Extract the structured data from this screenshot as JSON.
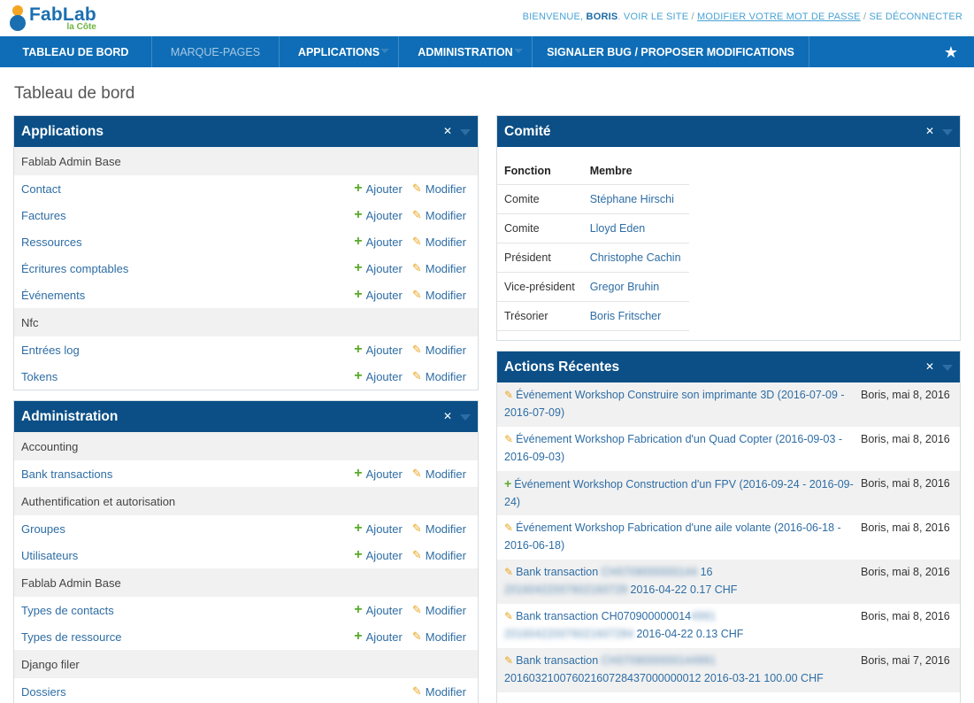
{
  "logo": {
    "title": "FabLab",
    "subtitle": "la Côte"
  },
  "user_links": {
    "welcome": "BIENVENUE,",
    "user": "BORIS",
    "view_site": "VOIR LE SITE",
    "change_password": "MODIFIER VOTRE MOT DE PASSE",
    "logout": "SE DÉCONNECTER"
  },
  "nav": {
    "items": [
      {
        "label": "TABLEAU DE BORD"
      },
      {
        "label": "MARQUE-PAGES"
      },
      {
        "label": "APPLICATIONS"
      },
      {
        "label": "ADMINISTRATION"
      },
      {
        "label": "SIGNALER BUG / PROPOSER MODIFICATIONS"
      }
    ],
    "star_icon": "star-icon"
  },
  "page_title": "Tableau de bord",
  "actions": {
    "add": "Ajouter",
    "edit": "Modifier"
  },
  "applications_panel": {
    "title": "Applications",
    "rows": [
      {
        "label": "Fablab Admin Base"
      },
      {
        "label": "Contact"
      },
      {
        "label": "Factures"
      },
      {
        "label": "Ressources"
      },
      {
        "label": "Écritures comptables"
      },
      {
        "label": "Événements"
      },
      {
        "label": "Nfc"
      },
      {
        "label": "Entrées log"
      },
      {
        "label": "Tokens"
      }
    ]
  },
  "administration_panel": {
    "title": "Administration",
    "rows": [
      {
        "label": "Accounting"
      },
      {
        "label": "Bank transactions"
      },
      {
        "label": "Authentification et autorisation"
      },
      {
        "label": "Groupes"
      },
      {
        "label": "Utilisateurs"
      },
      {
        "label": "Fablab Admin Base"
      },
      {
        "label": "Types de contacts"
      },
      {
        "label": "Types de ressource"
      },
      {
        "label": "Django filer"
      },
      {
        "label": "Dossiers"
      }
    ]
  },
  "comite_panel": {
    "title": "Comité",
    "headers": {
      "role": "Fonction",
      "member": "Membre"
    },
    "rows": [
      {
        "role": "Comite",
        "member": "Stéphane Hirschi"
      },
      {
        "role": "Comite",
        "member": "Lloyd Eden"
      },
      {
        "role": "Président",
        "member": "Christophe Cachin"
      },
      {
        "role": "Vice-président",
        "member": "Gregor Bruhin"
      },
      {
        "role": "Trésorier",
        "member": "Boris Fritscher"
      }
    ]
  },
  "recent_panel": {
    "title": "Actions Récentes",
    "rows": [
      {
        "text": "Événement Workshop Construire son imprimante 3D (2016-07-09 - 2016-07-09)",
        "who": "Boris, mai 8, 2016"
      },
      {
        "text": "Événement Workshop Fabrication d'un Quad Copter (2016-09-03 - 2016-09-03)",
        "who": "Boris, mai 8, 2016"
      },
      {
        "text": "Événement Workshop Construction d'un FPV (2016-09-24 - 2016-09-24)",
        "who": "Boris, mai 8, 2016"
      },
      {
        "text": "Événement Workshop Fabrication d'une aile volante (2016-06-18 - 2016-06-18)",
        "who": "Boris, mai 8, 2016"
      },
      {
        "text_a": "Bank transaction",
        "text_b": "16",
        "text_c": "2016-04-22 0.17 CHF",
        "who": "Boris, mai 8, 2016"
      },
      {
        "text_a": "Bank transaction",
        "text_b": "CH070900000014",
        "text_c": "2016-04-22 0.13 CHF",
        "who": "Boris, mai 8, 2016"
      },
      {
        "text_a": "Bank transaction",
        "text_c": "20160321007602160728437000000012 2016-03-21 100.00 CHF",
        "who": "Boris, mai 7, 2016"
      }
    ]
  }
}
